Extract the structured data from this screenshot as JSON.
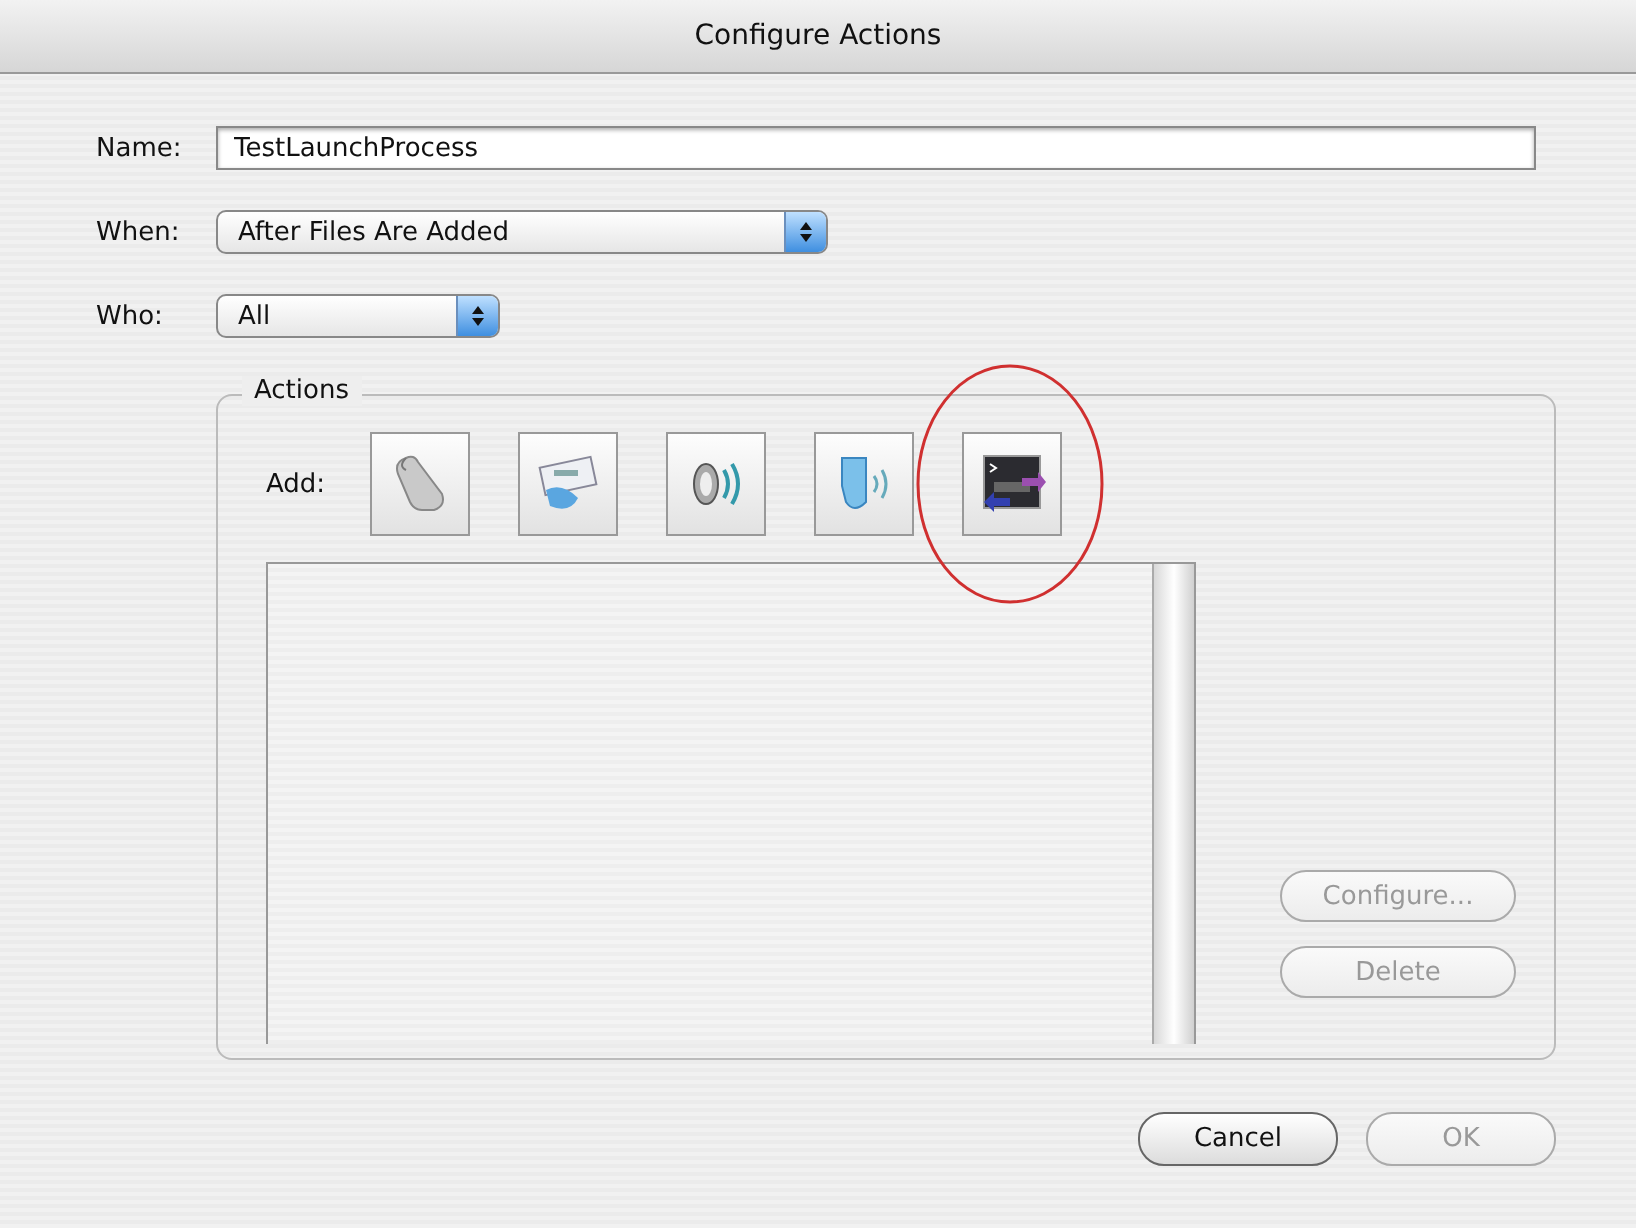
{
  "window": {
    "title": "Configure Actions"
  },
  "name_field": {
    "label": "Name:",
    "value": "TestLaunchProcess"
  },
  "when_field": {
    "label": "When:",
    "value": "After Files Are Added"
  },
  "who_field": {
    "label": "Who:",
    "value": "All"
  },
  "actions": {
    "title": "Actions",
    "add_label": "Add:",
    "add_buttons": [
      {
        "kind": "script",
        "highlighted": false
      },
      {
        "kind": "mail",
        "highlighted": false
      },
      {
        "kind": "sound",
        "highlighted": false
      },
      {
        "kind": "message",
        "highlighted": false
      },
      {
        "kind": "process",
        "highlighted": true
      }
    ],
    "side_buttons": [
      {
        "label": "Configure...",
        "disabled": true
      },
      {
        "label": "Delete",
        "disabled": true
      }
    ]
  },
  "buttons": [
    {
      "label": "Cancel",
      "disabled": false
    },
    {
      "label": "OK",
      "disabled": true
    }
  ]
}
